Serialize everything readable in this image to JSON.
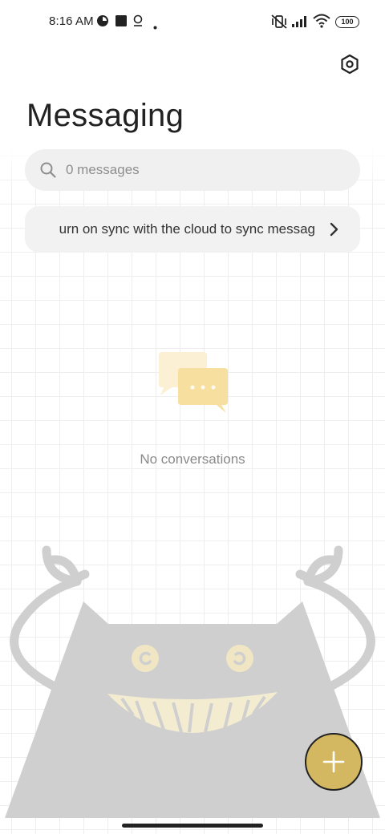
{
  "status_bar": {
    "time": "8:16 AM",
    "battery": "100",
    "icons": [
      "notification-app-icon",
      "square-notification-icon",
      "location-pin-icon",
      "dot-icon",
      "vibrate-muted-icon",
      "signal-icon",
      "wifi-icon",
      "battery-icon"
    ]
  },
  "header": {
    "title": "Messaging",
    "settings_icon": "hexagon-settings-icon"
  },
  "search": {
    "placeholder": "0 messages",
    "icon": "search-icon"
  },
  "sync_banner": {
    "text": "urn on sync with the cloud to sync messag",
    "icon": "chevron-right-icon"
  },
  "empty_state": {
    "icon": "chat-bubbles-icon",
    "text": "No conversations"
  },
  "fab": {
    "icon": "plus-icon"
  },
  "colors": {
    "accent": "#d4b861",
    "empty_icon_back": "#fbf0d3",
    "empty_icon_front": "#f7dfa0",
    "monster_body": "#cfcfcf",
    "monster_teeth": "#f4ecd0",
    "monster_eyes": "#f1e6c4"
  }
}
